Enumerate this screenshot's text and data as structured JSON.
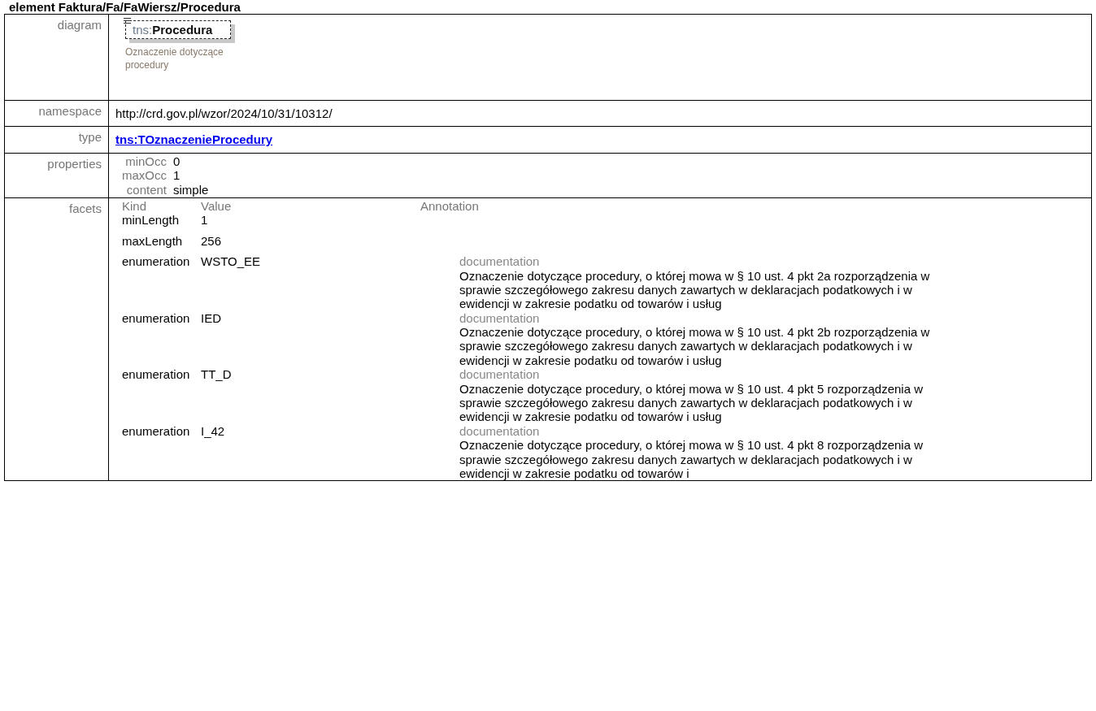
{
  "heading": "element Faktura/Fa/FaWiersz/Procedura",
  "diagram": {
    "label": "diagram",
    "prefix": "tns:",
    "name": "Procedura",
    "annotation": "Oznaczenie dotyczące procedury"
  },
  "namespace": {
    "label": "namespace",
    "value": "http://crd.gov.pl/wzor/2024/10/31/10312/"
  },
  "type": {
    "label": "type",
    "value": "tns:TOznaczenieProcedury"
  },
  "properties": {
    "label": "properties",
    "items": [
      {
        "key": "minOcc",
        "value": "0"
      },
      {
        "key": "maxOcc",
        "value": "1"
      },
      {
        "key": "content",
        "value": "simple"
      }
    ]
  },
  "facets": {
    "label": "facets",
    "columns": [
      "Kind",
      "Value",
      "Annotation"
    ],
    "rows": [
      {
        "kind": "minLength",
        "value": "1"
      },
      {
        "kind": "maxLength",
        "value": "256"
      },
      {
        "kind": "enumeration",
        "value": "WSTO_EE",
        "doc_label": "documentation",
        "doc": "Oznaczenie dotyczące procedury, o której mowa w § 10 ust. 4 pkt 2a rozporządzenia w sprawie szczegółowego zakresu danych zawartych w deklaracjach podatkowych i w ewidencji w zakresie podatku od towarów i usług"
      },
      {
        "kind": "enumeration",
        "value": "IED",
        "doc_label": "documentation",
        "doc": "Oznaczenie dotyczące procedury, o której mowa w § 10 ust. 4 pkt 2b rozporządzenia w sprawie szczegółowego zakresu danych zawartych w deklaracjach podatkowych i w ewidencji w zakresie podatku od towarów i usług"
      },
      {
        "kind": "enumeration",
        "value": "TT_D",
        "doc_label": "documentation",
        "doc": "Oznaczenie dotyczące procedury, o której mowa w § 10 ust. 4 pkt 5 rozporządzenia w sprawie szczegółowego zakresu danych zawartych w deklaracjach podatkowych i w ewidencji w zakresie podatku od towarów i usług"
      },
      {
        "kind": "enumeration",
        "value": "I_42",
        "doc_label": "documentation",
        "doc": "Oznaczenie dotyczące procedury, o której mowa w § 10 ust. 4 pkt 8 rozporządzenia w sprawie szczegółowego zakresu danych zawartych w deklaracjach podatkowych i w ewidencji w zakresie podatku od towarów i"
      }
    ]
  }
}
